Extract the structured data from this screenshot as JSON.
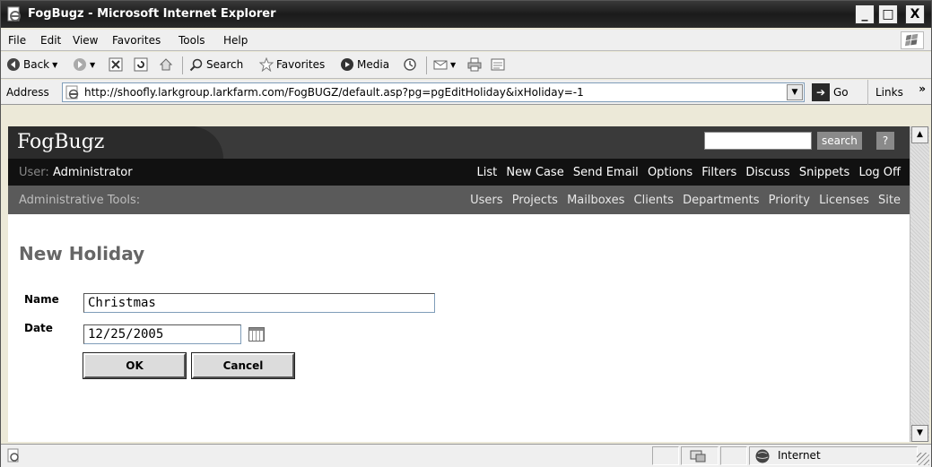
{
  "window": {
    "title": "FogBugz - Microsoft Internet Explorer",
    "minimize": "_",
    "maximize": "□",
    "close": "X"
  },
  "menu": [
    "File",
    "Edit",
    "View",
    "Favorites",
    "Tools",
    "Help"
  ],
  "toolbar": {
    "back": "Back",
    "search": "Search",
    "favorites": "Favorites",
    "media": "Media"
  },
  "address": {
    "label": "Address",
    "url": "http://shoofly.larkgroup.larkfarm.com/FogBUGZ/default.asp?pg=pgEditHoliday&ixHoliday=-1",
    "go": "Go",
    "links": "Links",
    "links_chevron": "»"
  },
  "fogbugz": {
    "logo": "FogBugz",
    "search_button": "search",
    "help_button": "?",
    "user_label": "User:",
    "user_name": "Administrator",
    "nav": [
      "List",
      "New Case",
      "Send Email",
      "Options",
      "Filters",
      "Discuss",
      "Snippets",
      "Log Off"
    ],
    "admin_label": "Administrative Tools:",
    "admin_nav": [
      "Users",
      "Projects",
      "Mailboxes",
      "Clients",
      "Departments",
      "Priority",
      "Licenses",
      "Site"
    ]
  },
  "form": {
    "title": "New Holiday",
    "name_label": "Name",
    "name_value": "Christmas",
    "date_label": "Date",
    "date_value": "12/25/2005",
    "ok_button": "OK",
    "cancel_button": "Cancel"
  },
  "status": {
    "zone": "Internet"
  }
}
